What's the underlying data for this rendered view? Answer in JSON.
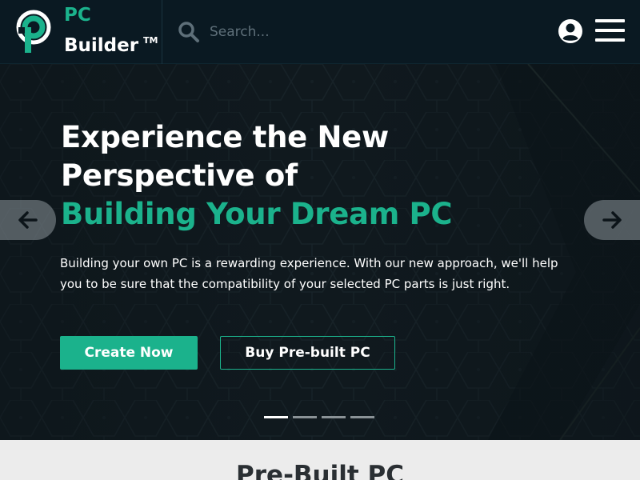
{
  "header": {
    "brand_line1": "PC",
    "brand_line2": "Builder",
    "brand_tm": "TM",
    "search_placeholder": "Search...",
    "icons": [
      "logo-icon",
      "search-icon",
      "user-account-icon",
      "hamburger-menu-icon"
    ]
  },
  "hero": {
    "title_line1": "Experience the New",
    "title_line2": "Perspective of",
    "title_accent": "Building Your Dream PC",
    "description": "Building your own PC is a rewarding experience. With our new approach, we'll help you to be sure that the compatibility of your selected PC parts is just right.",
    "primary_button": "Create Now",
    "secondary_button": "Buy Pre-built PC",
    "carousel": {
      "slide_count": 4,
      "active_index": 0
    }
  },
  "section": {
    "title": "Pre-Built PC"
  },
  "colors": {
    "accent": "#1bb28c",
    "header_bg": "#0a1922",
    "hero_bg": "#0c1419",
    "section_bg": "#ececec"
  }
}
